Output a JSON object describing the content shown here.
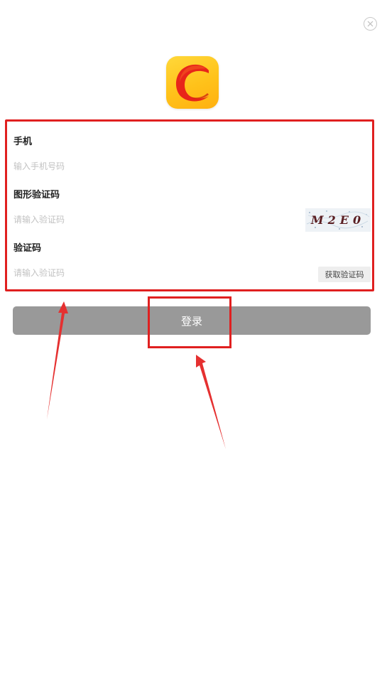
{
  "close_icon": "close-circle-icon",
  "logo_icon": "app-logo-c-icon",
  "colors": {
    "logo_yellow": "#ffc21a",
    "logo_red": "#e8251a",
    "login_button": "#999999",
    "annotation_red": "#e02020"
  },
  "form": {
    "phone": {
      "label": "手机",
      "placeholder": "输入手机号码"
    },
    "captcha": {
      "label": "图形验证码",
      "placeholder": "请输入验证码",
      "image_text": "M2E0"
    },
    "sms_code": {
      "label": "验证码",
      "placeholder": "请输入验证码",
      "get_code_label": "获取验证码"
    }
  },
  "login": {
    "label": "登录"
  }
}
